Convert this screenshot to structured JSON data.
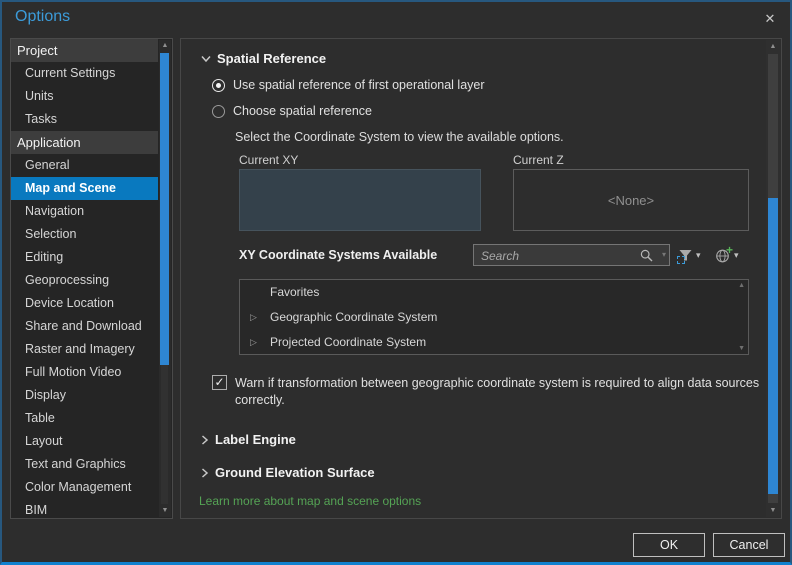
{
  "window": {
    "title": "Options"
  },
  "icons": {
    "close": "✕",
    "dropdown_arrow": "▾",
    "scroll_up": "▲",
    "scroll_down": "▼",
    "tree_expander": "▷",
    "checkmark": "✓"
  },
  "colors": {
    "accent_blue": "#0979bf",
    "title_blue": "#3c9bd9",
    "scrollbar_blue": "#2e86d3",
    "link_green": "#55a355",
    "current_xy_fill": "#34414b"
  },
  "sidebar": {
    "selected": "Map and Scene",
    "groups": [
      {
        "label": "Project",
        "items": [
          "Current Settings",
          "Units",
          "Tasks"
        ]
      },
      {
        "label": "Application",
        "items": [
          "General",
          "Map and Scene",
          "Navigation",
          "Selection",
          "Editing",
          "Geoprocessing",
          "Device Location",
          "Share and Download",
          "Raster and Imagery",
          "Full Motion Video",
          "Display",
          "Table",
          "Layout",
          "Text and Graphics",
          "Color Management",
          "BIM"
        ]
      }
    ]
  },
  "content": {
    "spatial_reference": {
      "title": "Spatial Reference",
      "radios": [
        {
          "label": "Use spatial reference of first operational layer",
          "selected": true
        },
        {
          "label": "Choose spatial reference",
          "selected": false
        }
      ],
      "instruction": "Select the Coordinate System to view the available options.",
      "current_xy": {
        "label": "Current XY",
        "value": ""
      },
      "current_z": {
        "label": "Current Z",
        "value": "<None>"
      },
      "xy_systems_label": "XY Coordinate Systems Available",
      "search": {
        "placeholder": "Search"
      },
      "tree": {
        "items": [
          {
            "label": "Favorites",
            "expandable": false
          },
          {
            "label": "Geographic Coordinate System",
            "expandable": true
          },
          {
            "label": "Projected Coordinate System",
            "expandable": true
          }
        ]
      },
      "warning": {
        "checked": true,
        "label": "Warn if transformation between geographic coordinate system is required to align data sources correctly."
      }
    },
    "collapsed_sections": [
      {
        "title": "Label Engine"
      },
      {
        "title": "Ground Elevation Surface"
      }
    ],
    "link": "Learn more about map and scene options"
  },
  "footer": {
    "ok_label": "OK",
    "cancel_label": "Cancel"
  }
}
